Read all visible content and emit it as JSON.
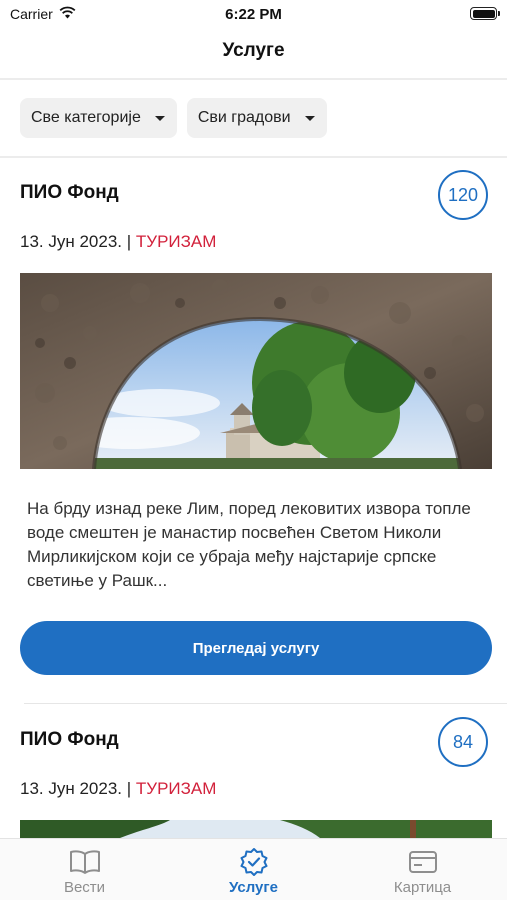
{
  "status_bar": {
    "carrier": "Carrier",
    "time": "6:22 PM"
  },
  "nav": {
    "title": "Услуге"
  },
  "filters": {
    "category": "Све категорије",
    "city": "Сви градови"
  },
  "cards": [
    {
      "title": "ПИО Фонд",
      "count": "120",
      "date": "13. Јун 2023.",
      "separator": "|",
      "category": "ТУРИЗАМ",
      "description": "На брду изнад реке Лим, поред лековитих извора топле воде смештен је манастир посвећен Светом Николи Мирликијском који се убраја међу најстарије српске светиње у Рашк...",
      "button": "Прегледај услугу"
    },
    {
      "title": "ПИО Фонд",
      "count": "84",
      "date": "13. Јун 2023.",
      "separator": "|",
      "category": "ТУРИЗАМ"
    }
  ],
  "tabs": [
    {
      "label": "Вести",
      "icon": "book-icon",
      "active": false
    },
    {
      "label": "Услуге",
      "icon": "verified-badge-icon",
      "active": true
    },
    {
      "label": "Картица",
      "icon": "card-icon",
      "active": false
    }
  ],
  "colors": {
    "accent": "#1f6fc2",
    "category": "#d2213b"
  }
}
